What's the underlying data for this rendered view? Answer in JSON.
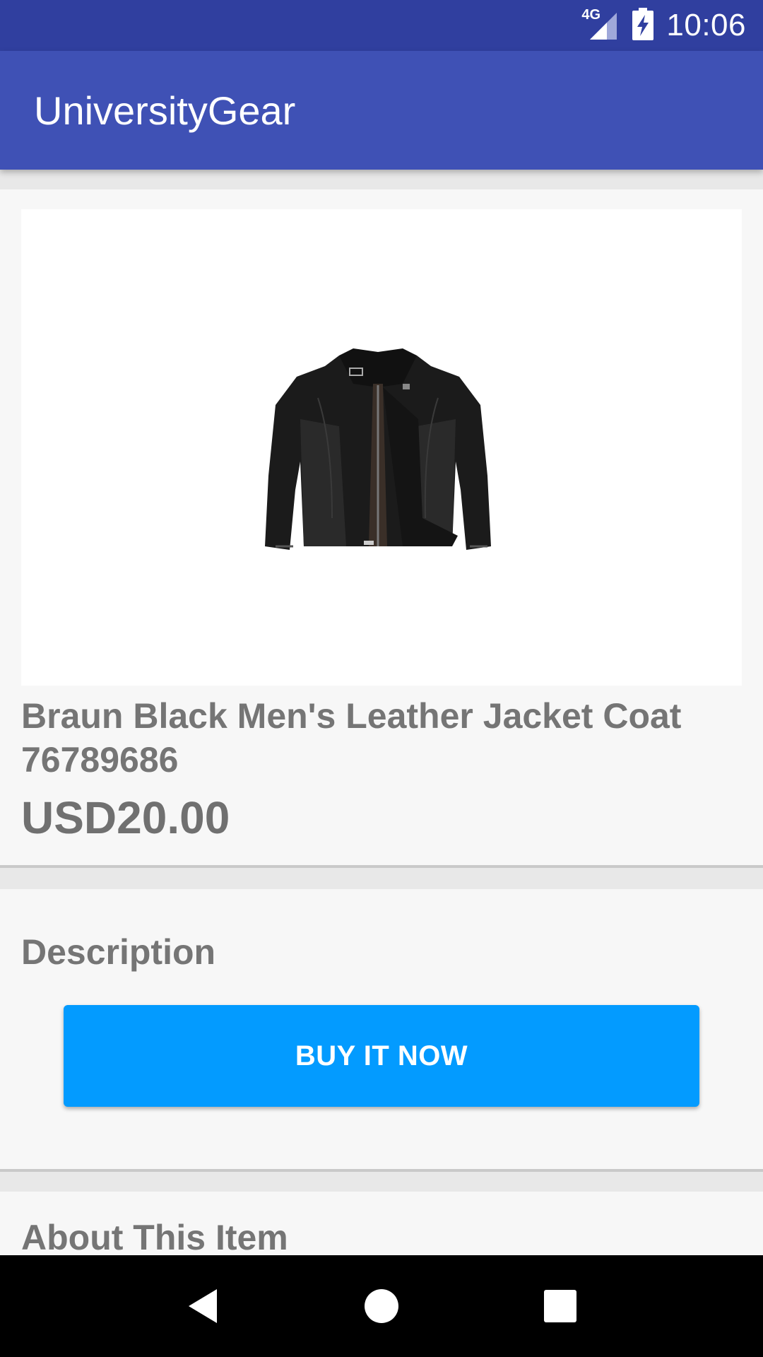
{
  "status_bar": {
    "network": "4G",
    "time": "10:06",
    "icons": [
      "signal-icon",
      "battery-charging-icon"
    ]
  },
  "app_bar": {
    "title": "UniversityGear",
    "color": "#3f51b5"
  },
  "product": {
    "image": "leather-jacket-image",
    "title": " Braun Black Men's Leather Jacket Coat 76789686",
    "price": "USD20.00"
  },
  "description": {
    "heading": "Description",
    "buy_label": "BUY IT NOW",
    "button_color": "#039bff"
  },
  "about": {
    "heading": "About This Item"
  },
  "nav_bar": {
    "icons": [
      "back-icon",
      "home-icon",
      "recents-icon"
    ]
  }
}
